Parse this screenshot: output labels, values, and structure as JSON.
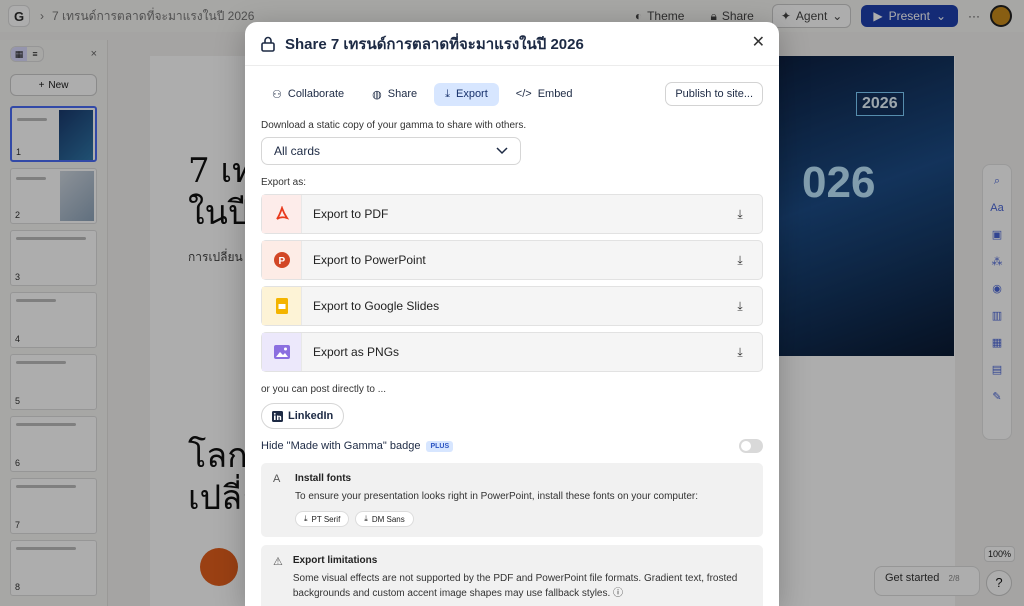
{
  "topbar": {
    "doc_title": "7 เทรนด์การตลาดที่จะมาแรงในปี 2026",
    "theme_label": "Theme",
    "share_label": "Share",
    "agent_label": "Agent",
    "present_label": "Present",
    "more_label": "···"
  },
  "sidebar": {
    "new_label": "New",
    "slides": [
      "1",
      "2",
      "3",
      "4",
      "5",
      "6",
      "7",
      "8"
    ]
  },
  "canvas": {
    "title_line1": "7 เท",
    "title_line2": "ในปี",
    "subtitle": "การเปลี่ยน",
    "title2_line1": "โลก",
    "title2_line2": "เปลี่ย",
    "hero_year_tag": "2026",
    "hero_year_big": "026",
    "zoom": "100%",
    "get_started": "Get started",
    "get_started_progress": "2/8",
    "help": "?"
  },
  "modal": {
    "title": "Share 7 เทรนด์การตลาดที่จะมาแรงในปี 2026",
    "tabs": [
      "Collaborate",
      "Share",
      "Export",
      "Embed"
    ],
    "active_tab": "Export",
    "publish_label": "Publish to site...",
    "description": "Download a static copy of your gamma to share with others.",
    "select_value": "All cards",
    "export_as_label": "Export as:",
    "exports": [
      {
        "label": "Export to PDF",
        "icon": "pdf-icon",
        "color": "#e8391c"
      },
      {
        "label": "Export to PowerPoint",
        "icon": "powerpoint-icon",
        "color": "#d24726"
      },
      {
        "label": "Export to Google Slides",
        "icon": "google-slides-icon",
        "color": "#f4b400"
      },
      {
        "label": "Export as PNGs",
        "icon": "image-icon",
        "color": "#8b6fe0"
      }
    ],
    "post_label": "or you can post directly to ...",
    "linkedin_label": "LinkedIn",
    "badge_label": "Hide \"Made with Gamma\" badge",
    "plus_label": "PLUS",
    "badge_enabled": false,
    "install_fonts": {
      "title": "Install fonts",
      "text": "To ensure your presentation looks right in PowerPoint, install these fonts on your computer:",
      "fonts": [
        "PT Serif",
        "DM Sans"
      ]
    },
    "export_limitations": {
      "title": "Export limitations",
      "text": "Some visual effects are not supported by the PDF and PowerPoint file formats. Gradient text, frosted backgrounds and custom accent image shapes may use fallback styles."
    }
  }
}
